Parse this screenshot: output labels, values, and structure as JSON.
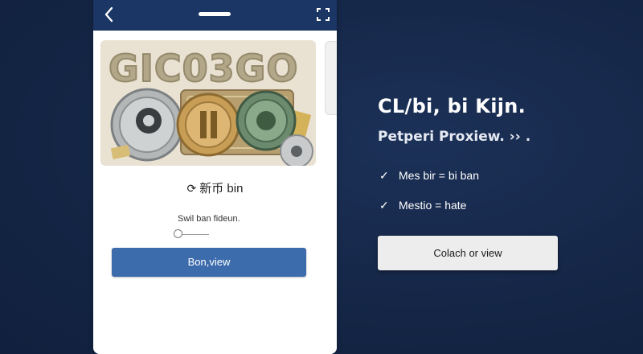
{
  "colors": {
    "background": "#17294a",
    "phone_header": "#1b3564",
    "primary_button": "#3d6cad",
    "secondary_button": "#ededed"
  },
  "phone": {
    "back_icon": "chevron-left-icon",
    "expand_icon": "expand-icon",
    "hero_title": "GIC03GO",
    "coin_label": "新币 bin",
    "coin_icon": "refresh-icon",
    "slider_label": "Swil ban fideun.",
    "primary_button_label": "Bon,view"
  },
  "promo": {
    "headline": "CL/bi, bi Kijn.",
    "subheadline": "Petperi Proxiew. ›› .",
    "features": [
      {
        "icon": "check-icon",
        "label": "Mes bir = bi ban"
      },
      {
        "icon": "check-icon",
        "label": "Mestio = hate"
      }
    ],
    "cta_label": "Colach or view"
  }
}
